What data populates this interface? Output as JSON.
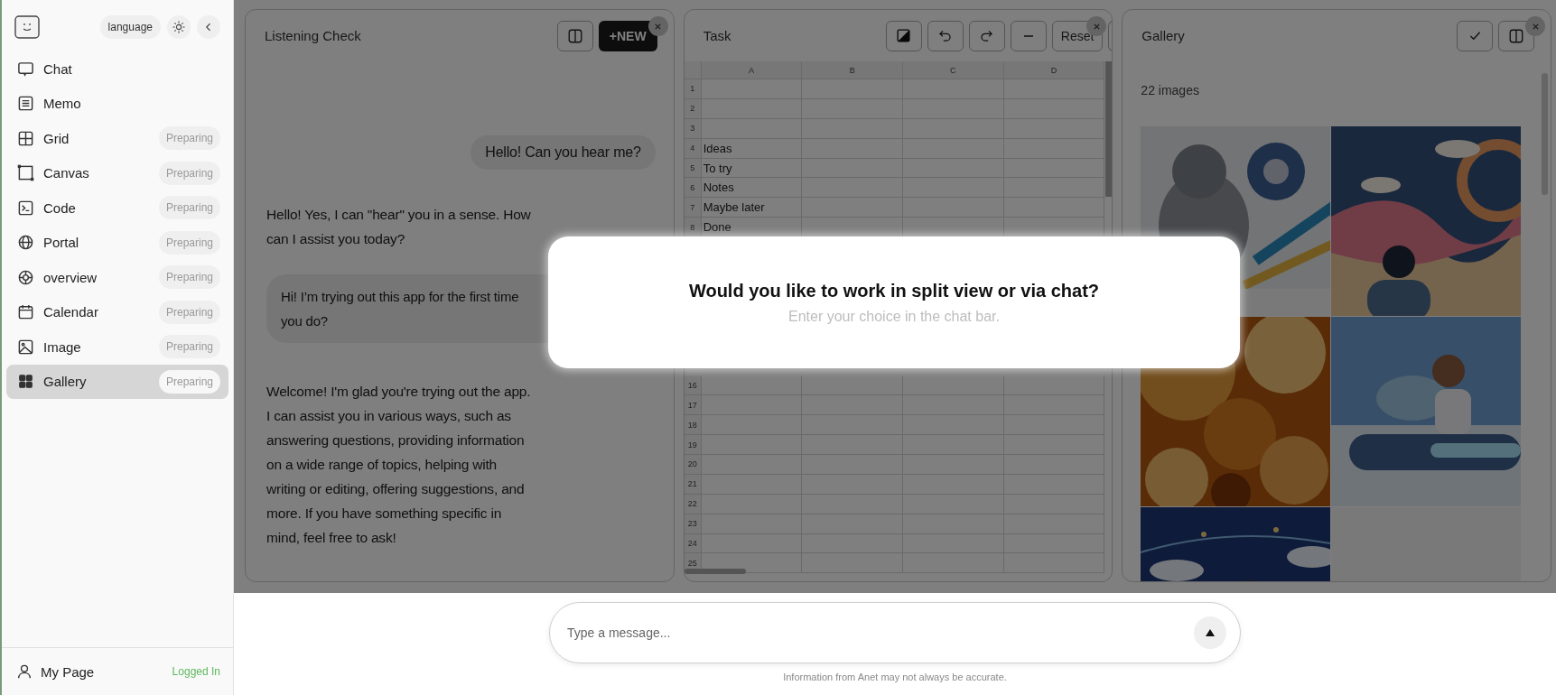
{
  "sidebar": {
    "language_button": "language",
    "nav": [
      {
        "label": "Chat",
        "selected": false
      },
      {
        "label": "Memo",
        "selected": false
      },
      {
        "label": "Grid",
        "badge": "Preparing",
        "selected": false
      },
      {
        "label": "Canvas",
        "badge": "Preparing",
        "selected": false
      },
      {
        "label": "Code",
        "badge": "Preparing",
        "selected": false
      },
      {
        "label": "Portal",
        "badge": "Preparing",
        "selected": false
      },
      {
        "label": "overview",
        "badge": "Preparing",
        "selected": false
      },
      {
        "label": "Calendar",
        "badge": "Preparing",
        "selected": false
      },
      {
        "label": "Image",
        "badge": "Preparing",
        "selected": false
      },
      {
        "label": "Gallery",
        "badge": "Preparing",
        "selected": true
      }
    ],
    "user": {
      "label": "My Page",
      "status": "Logged In"
    }
  },
  "chat_panel": {
    "title": "Listening Check",
    "new_button": "+NEW",
    "messages": [
      {
        "kind": "user",
        "lines": [
          "Hello! Can you hear me?"
        ]
      },
      {
        "kind": "assistant",
        "lines": [
          "Hello! Yes, I can \"hear\" you in a sense. How can I assist you today?"
        ]
      },
      {
        "kind": "user",
        "lines": [
          "Hi! I’m trying out this app for the first time",
          "you do?"
        ]
      },
      {
        "kind": "assistant",
        "lines": [
          "Welcome! I'm glad you're trying out the app. I can assist you in various ways, such as answering questions, providing information on a wide range of topics, helping with writing or editing, offering suggestions, and more. If you have something specific in mind, feel free to ask!"
        ]
      }
    ]
  },
  "task_panel": {
    "title": "Task",
    "reset_button": "Reset",
    "columns": [
      "A",
      "B",
      "C",
      "D"
    ],
    "rows": [
      {
        "number": "1"
      },
      {
        "number": "2"
      },
      {
        "number": "3"
      },
      {
        "number": "4",
        "a": "Ideas"
      },
      {
        "number": "5",
        "a": "To try"
      },
      {
        "number": "6",
        "a": "Notes"
      },
      {
        "number": "7",
        "a": "Maybe later"
      },
      {
        "number": "8",
        "a": "Done"
      },
      {
        "number": "16"
      },
      {
        "number": "17"
      },
      {
        "number": "18"
      },
      {
        "number": "19"
      },
      {
        "number": "20"
      },
      {
        "number": "21"
      },
      {
        "number": "22"
      },
      {
        "number": "23"
      },
      {
        "number": "24"
      },
      {
        "number": "25"
      }
    ]
  },
  "gallery_panel": {
    "title": "Gallery",
    "count": "22 images"
  },
  "modal": {
    "title": "Would you like to work in split view or via chat?",
    "subtitle": "Enter your choice in the chat bar."
  },
  "composer": {
    "placeholder": "Type a message..."
  },
  "footer_note": "Information from Anet may not always be accurate."
}
